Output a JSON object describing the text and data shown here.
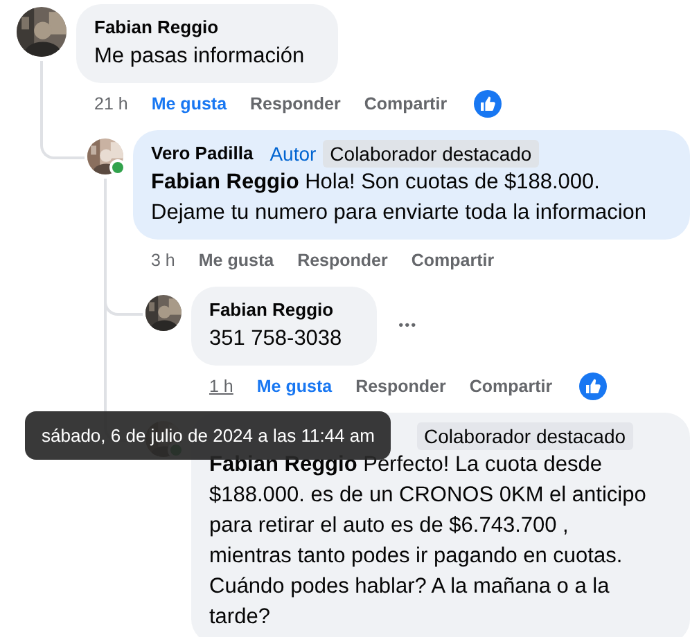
{
  "thread": {
    "comments": [
      {
        "author": "Fabian Reggio",
        "online": false,
        "highlighted": false,
        "text": "Me pasas información",
        "time": "21 h",
        "time_hovered": false,
        "actions": [
          {
            "label": "Me gusta",
            "selected": true
          },
          {
            "label": "Responder",
            "selected": false
          },
          {
            "label": "Compartir",
            "selected": false
          }
        ],
        "reacted": true,
        "children": [
          {
            "author": "Vero Padilla",
            "author_tag": "Autor",
            "badge": "Colaborador destacado",
            "online": true,
            "highlighted": true,
            "text": "**Fabian Reggio** Hola! Son cuotas de $188.000. Dejame tu numero para enviarte toda la informacion",
            "time": "3 h",
            "time_hovered": false,
            "actions": [
              {
                "label": "Me gusta",
                "selected": false
              },
              {
                "label": "Responder",
                "selected": false
              },
              {
                "label": "Compartir",
                "selected": false
              }
            ],
            "reacted": false,
            "children": [
              {
                "author": "Fabian Reggio",
                "online": false,
                "highlighted": false,
                "text": "351 758-3038",
                "menu": "•••",
                "time": "1 h",
                "time_hovered": true,
                "actions": [
                  {
                    "label": "Me gusta",
                    "selected": true
                  },
                  {
                    "label": "Responder",
                    "selected": false
                  },
                  {
                    "label": "Compartir",
                    "selected": false
                  }
                ],
                "reacted": true
              },
              {
                "badge": "Colaborador destacado",
                "online": true,
                "highlighted": false,
                "text": "**Fabian Reggio** Perfecto! La cuota desde $188.000. es de un CRONOS 0KM el anticipo para retirar el auto es de $6.743.700 , mientras tanto podes ir pagando en cuotas. Cuándo podes hablar? A la mañana o a la tarde?"
              }
            ]
          }
        ]
      }
    ]
  },
  "tooltip": {
    "text": "sábado, 6 de julio de 2024 a las 11:44 am"
  }
}
